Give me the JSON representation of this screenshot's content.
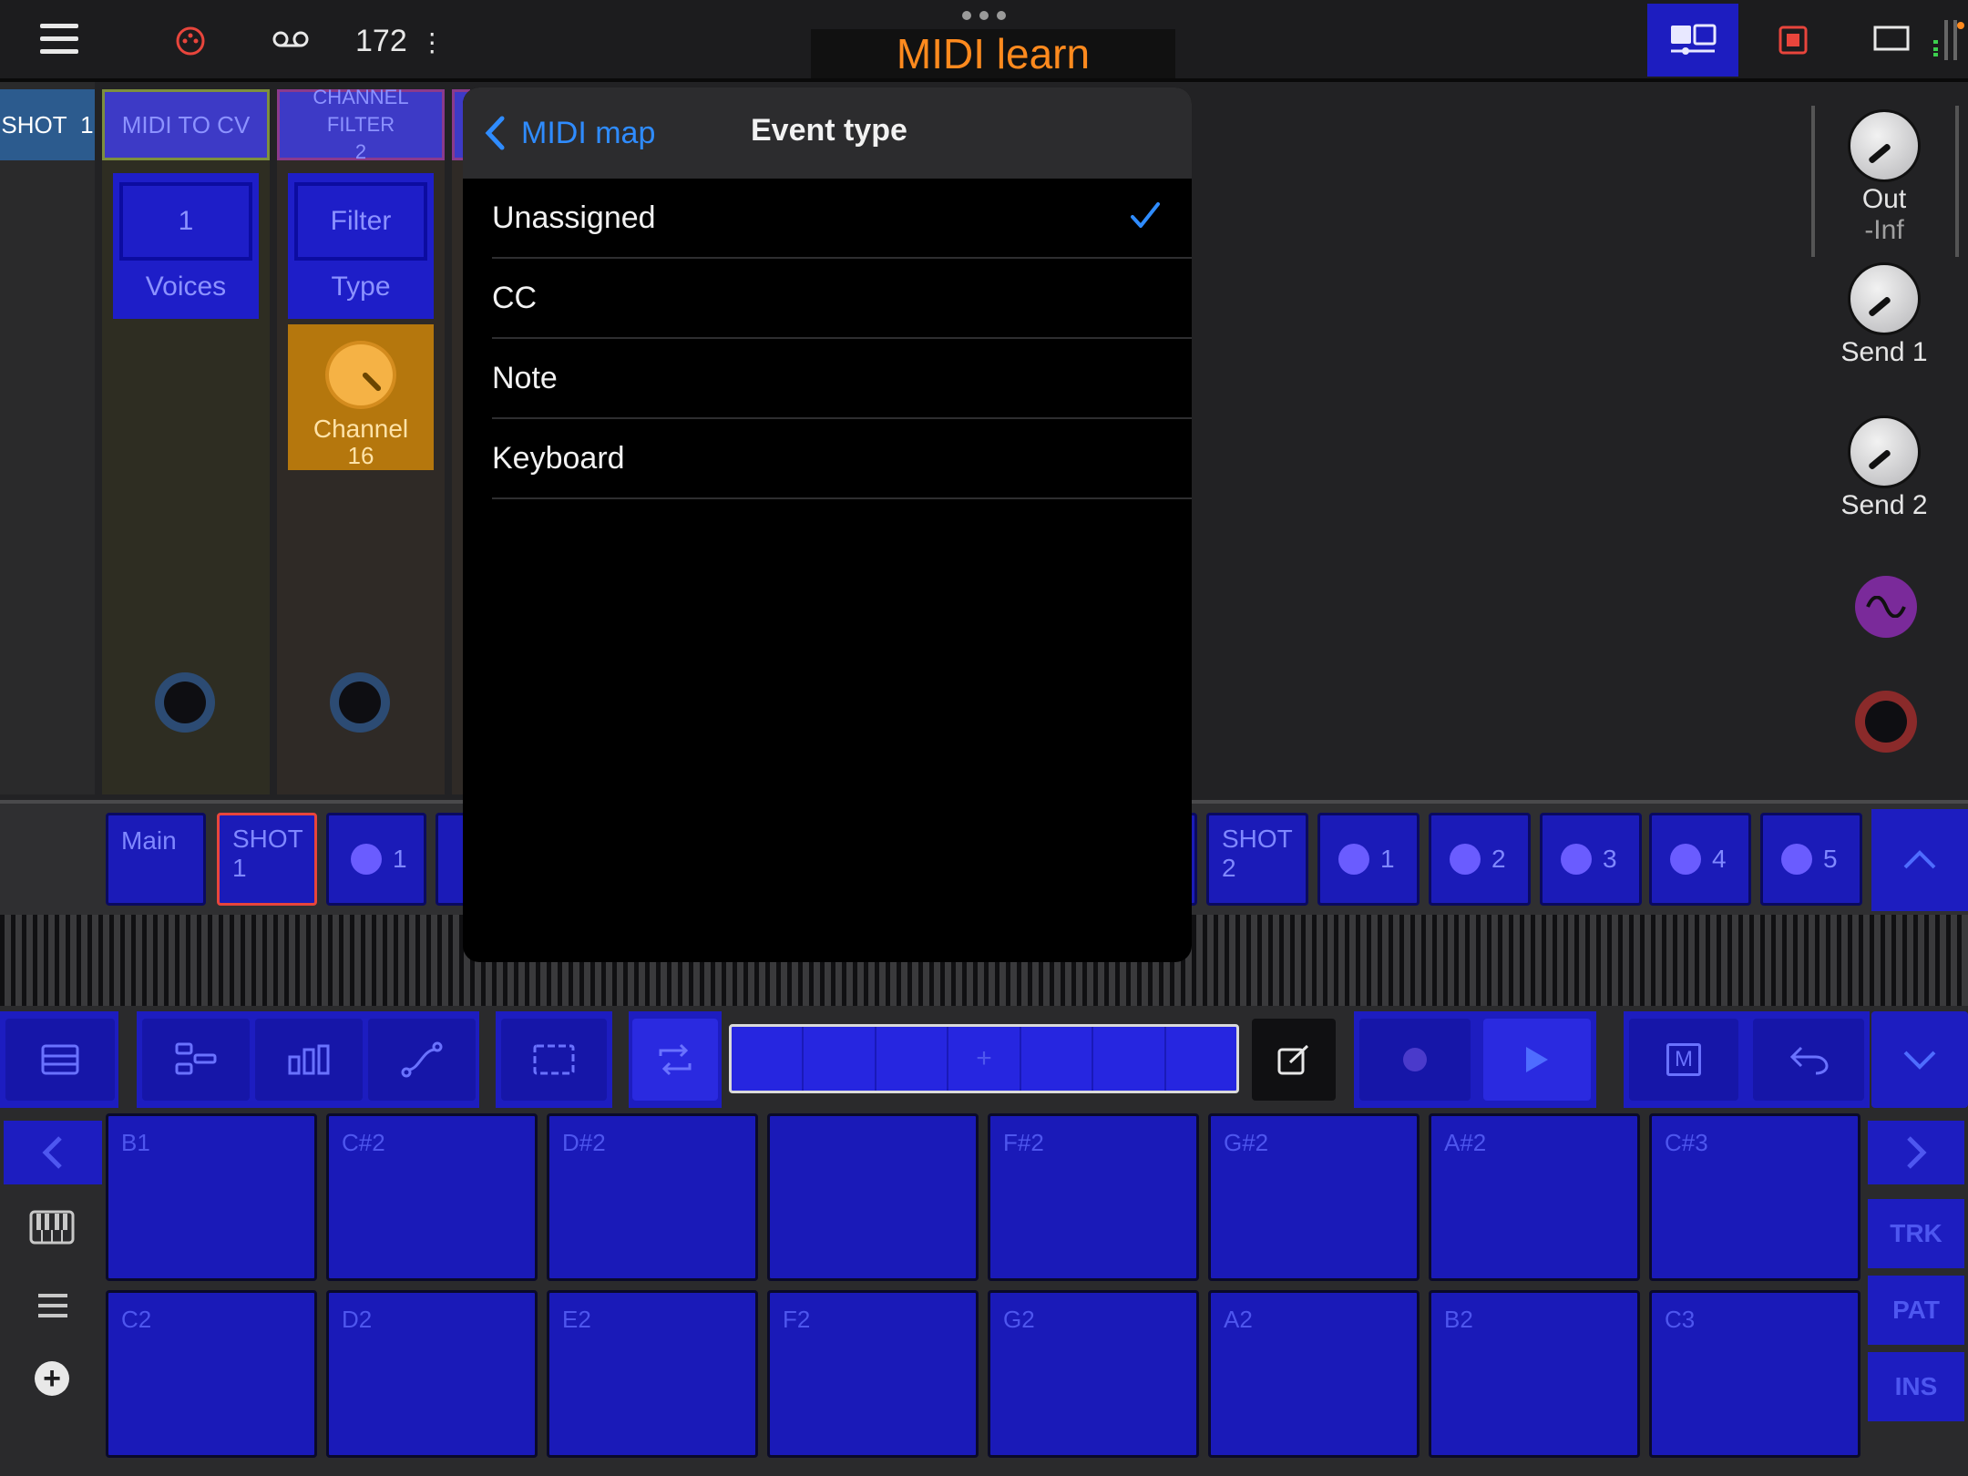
{
  "app": {
    "title": "MIDI learn",
    "bpm": "172",
    "bpm_menu_glyph": "⋮"
  },
  "topbar": {
    "menu_icon": "hamburger-icon",
    "midi_icon": "midi-port-icon",
    "loop_icon": "tape-icon",
    "layout_icon": "layout-icon",
    "record_icon": "record-stop-icon",
    "window_icon": "window-icon"
  },
  "tracks": {
    "shot": {
      "name": "SHOT",
      "num": "1"
    },
    "midi_to_cv": {
      "name": "MIDI TO CV",
      "param_value": "1",
      "param_label": "Voices"
    },
    "channel_filter": {
      "name": "CHANNEL FILTER",
      "num": "2",
      "param_value": "Filter",
      "param_label": "Type",
      "knob_label": "Channel",
      "knob_value": "16"
    }
  },
  "right_strip": {
    "out_label": "Out",
    "out_value": "-Inf",
    "send1_label": "Send 1",
    "send2_label": "Send 2"
  },
  "modal": {
    "back_label": "MIDI map",
    "title": "Event type",
    "items": [
      {
        "label": "Unassigned",
        "selected": true
      },
      {
        "label": "CC",
        "selected": false
      },
      {
        "label": "Note",
        "selected": false
      },
      {
        "label": "Keyboard",
        "selected": false
      }
    ],
    "check_glyph": "✓",
    "back_glyph": "‹"
  },
  "scenes": {
    "main": "Main",
    "shot1_a": "SHOT",
    "shot1_b": "1",
    "pad1": "1",
    "shot2_a": "SHOT",
    "shot2_b": "2",
    "s1": "1",
    "s2": "2",
    "s3": "3",
    "s4": "4",
    "s5": "5"
  },
  "toolbar": {
    "add_glyph": "+",
    "m_label": "M"
  },
  "pads": {
    "row1": [
      "B1",
      "C#2",
      "D#2",
      "",
      "F#2",
      "G#2",
      "A#2",
      "C#3"
    ],
    "row2": [
      "C2",
      "D2",
      "E2",
      "F2",
      "G2",
      "A2",
      "B2",
      "C3"
    ]
  },
  "side": {
    "trk": "TRK",
    "pat": "PAT",
    "ins": "INS",
    "plus_glyph": "+",
    "left_glyph": "‹",
    "right_glyph": "›"
  },
  "colors": {
    "accent_orange": "#ff8a1e",
    "ios_blue": "#2f8cff",
    "pad_blue": "#1a1ab8",
    "knob_orange": "#b5770d"
  }
}
